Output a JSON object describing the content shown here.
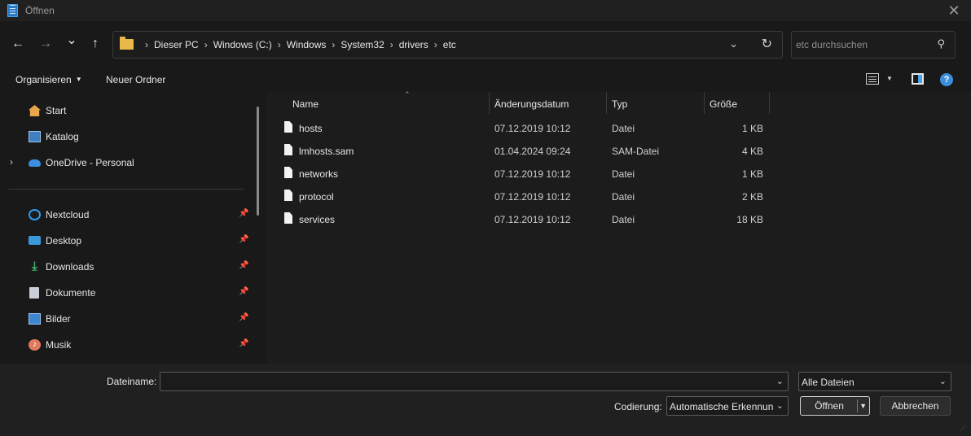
{
  "window": {
    "title": "Öffnen",
    "close_glyph": "✕"
  },
  "nav": {
    "back_glyph": "←",
    "forward_glyph": "→",
    "recent_glyph": "⌄",
    "up_glyph": "↑",
    "breadcrumbs": [
      "Dieser PC",
      "Windows (C:)",
      "Windows",
      "System32",
      "drivers",
      "etc"
    ],
    "separator": "›",
    "dropdown_glyph": "⌄",
    "refresh_glyph": "↻"
  },
  "search": {
    "placeholder": "etc durchsuchen",
    "icon_glyph": "⚲"
  },
  "toolbar": {
    "organize_label": "Organisieren",
    "new_folder_label": "Neuer Ordner",
    "caret": "▼",
    "help_glyph": "?"
  },
  "sidebar": {
    "items": [
      {
        "label": "Start",
        "icon": "home-icon"
      },
      {
        "label": "Katalog",
        "icon": "gallery-icon"
      },
      {
        "label": "OneDrive - Personal",
        "icon": "onedrive-icon",
        "expander": "›"
      },
      {
        "label": "Nextcloud",
        "icon": "nextcloud-icon",
        "pinned": true
      },
      {
        "label": "Desktop",
        "icon": "desktop-icon",
        "pinned": true
      },
      {
        "label": "Downloads",
        "icon": "downloads-icon",
        "pinned": true
      },
      {
        "label": "Dokumente",
        "icon": "documents-icon",
        "pinned": true
      },
      {
        "label": "Bilder",
        "icon": "pictures-icon",
        "pinned": true
      },
      {
        "label": "Musik",
        "icon": "music-icon",
        "pinned": true
      }
    ],
    "pin_glyph": "📌",
    "downloads_glyph": "⤓",
    "music_glyph": "♪"
  },
  "columns": {
    "name": "Name",
    "date": "Änderungsdatum",
    "type": "Typ",
    "size": "Größe",
    "sort_glyph": "⌃"
  },
  "files": [
    {
      "name": "hosts",
      "date": "07.12.2019 10:12",
      "type": "Datei",
      "size": "1 KB"
    },
    {
      "name": "lmhosts.sam",
      "date": "01.04.2024 09:24",
      "type": "SAM-Datei",
      "size": "4 KB"
    },
    {
      "name": "networks",
      "date": "07.12.2019 10:12",
      "type": "Datei",
      "size": "1 KB"
    },
    {
      "name": "protocol",
      "date": "07.12.2019 10:12",
      "type": "Datei",
      "size": "2 KB"
    },
    {
      "name": "services",
      "date": "07.12.2019 10:12",
      "type": "Datei",
      "size": "18 KB"
    }
  ],
  "bottom": {
    "filename_label": "Dateiname:",
    "filename_value": "",
    "filetype_value": "Alle Dateien",
    "encoding_label": "Codierung:",
    "encoding_value": "Automatische Erkennun",
    "open_label": "Öffnen",
    "cancel_label": "Abbrechen",
    "dropdown_glyph": "⌄",
    "split_caret": "▼",
    "grip_glyph": "⋰"
  },
  "colors": {
    "accent": "#3c8fdc",
    "folder": "#e8b84a",
    "background": "#1c1c1c"
  }
}
